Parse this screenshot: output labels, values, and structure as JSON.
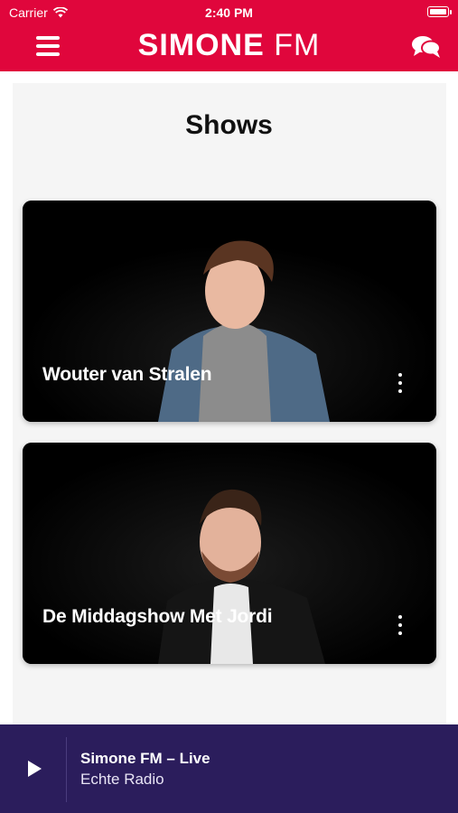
{
  "status_bar": {
    "carrier": "Carrier",
    "time": "2:40 PM"
  },
  "header": {
    "logo_bold": "SIMONE",
    "logo_light": "FM"
  },
  "page": {
    "title": "Shows"
  },
  "shows": [
    {
      "title": "Wouter van Stralen"
    },
    {
      "title": "De Middagshow Met Jordi"
    }
  ],
  "player": {
    "title": "Simone FM – Live",
    "subtitle": "Echte Radio"
  },
  "colors": {
    "brand": "#E0063C",
    "player_bg": "#2B1D5C",
    "page_bg": "#F5F5F5"
  }
}
